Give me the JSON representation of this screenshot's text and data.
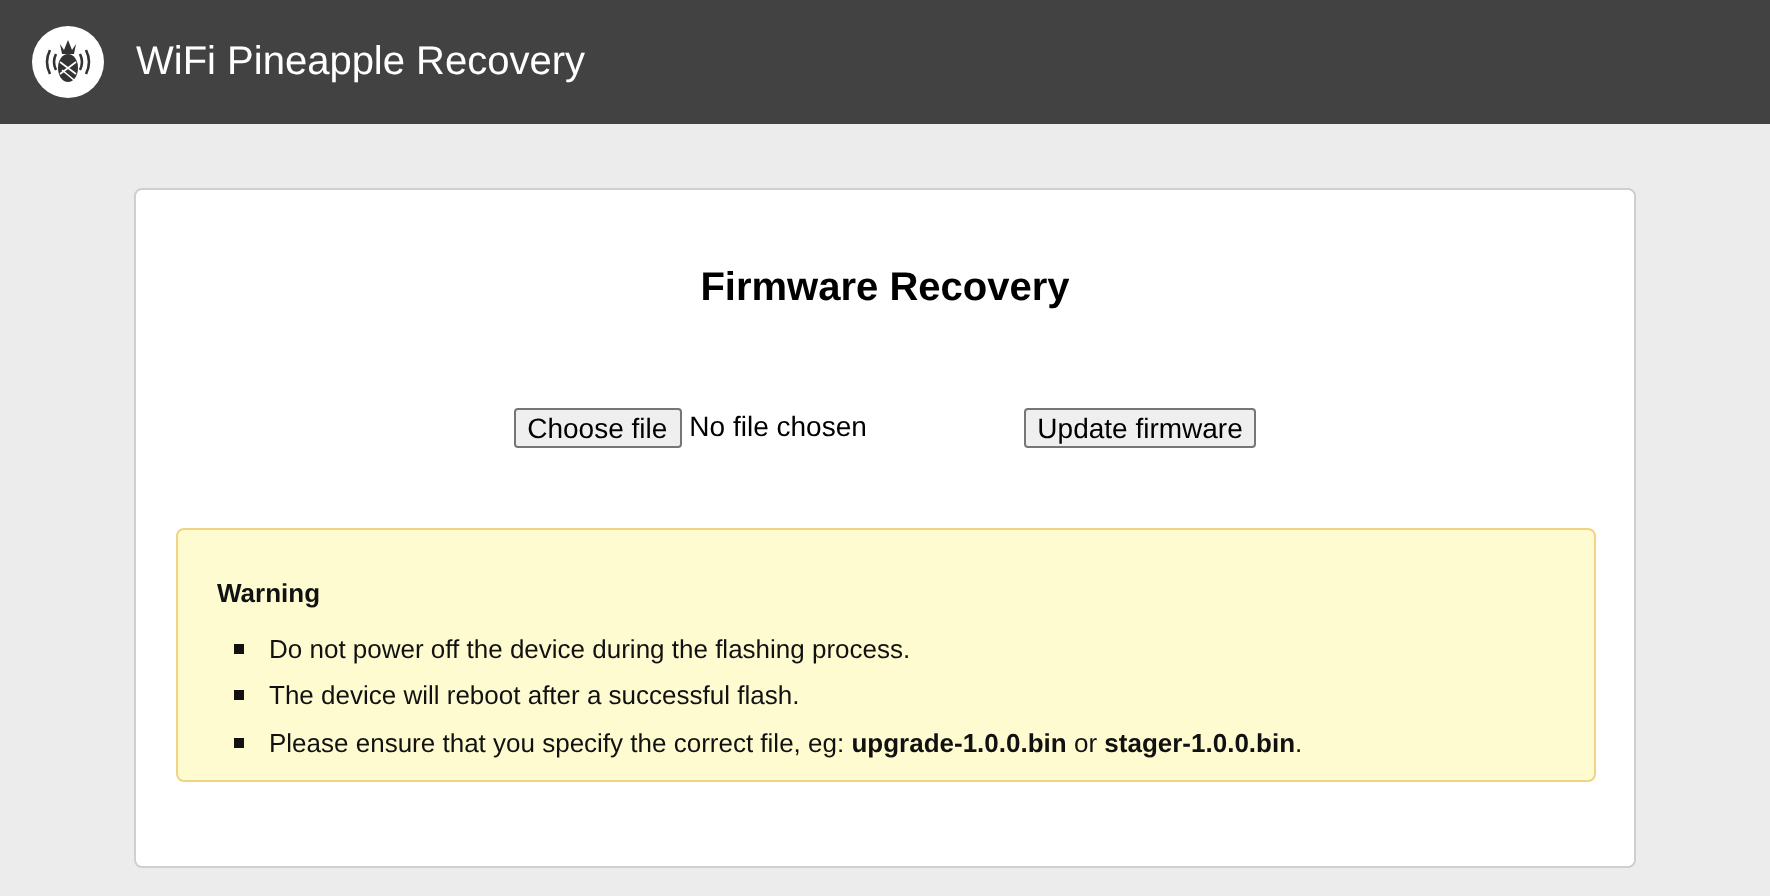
{
  "header": {
    "title": "WiFi Pineapple Recovery"
  },
  "card": {
    "title": "Firmware Recovery",
    "file_input": {
      "button": "Choose file",
      "status": "No file chosen"
    },
    "submit_button": "Update firmware",
    "warning": {
      "title": "Warning",
      "items": [
        "Do not power off the device during the flashing process.",
        "The device will reboot after a successful flash.",
        "Please ensure that you specify the correct file, eg: **upgrade-1.0.0.bin** or **stager-1.0.0.bin**."
      ]
    }
  }
}
